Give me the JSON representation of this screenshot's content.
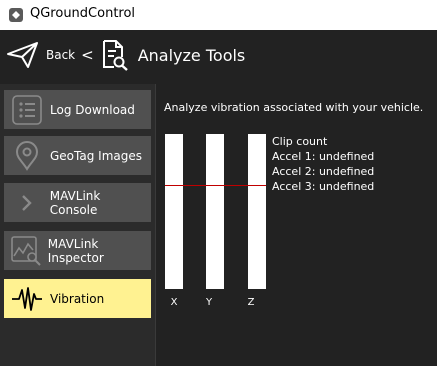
{
  "window": {
    "title": "QGroundControl"
  },
  "header": {
    "back_label": "Back",
    "separator": "<",
    "title": "Analyze Tools"
  },
  "sidebar": {
    "items": [
      {
        "label": "Log Download",
        "icon": "list-icon",
        "active": false
      },
      {
        "label": "GeoTag Images",
        "icon": "map-pin-icon",
        "active": false
      },
      {
        "label": "MAVLink Console",
        "icon": "terminal-chevron-icon",
        "active": false
      },
      {
        "label": "MAVLink Inspector",
        "icon": "chart-search-icon",
        "active": false
      },
      {
        "label": "Vibration",
        "icon": "waveform-icon",
        "active": true
      }
    ]
  },
  "main": {
    "description": "Analyze vibration associated with your vehicle.",
    "axes": [
      "X",
      "Y",
      "Z"
    ],
    "clip_title": "Clip count",
    "accels": [
      "Accel 1: undefined",
      "Accel 2: undefined",
      "Accel 3: undefined"
    ]
  },
  "colors": {
    "active_item": "#fff291",
    "clip_line": "#c00000",
    "background": "#222222"
  }
}
